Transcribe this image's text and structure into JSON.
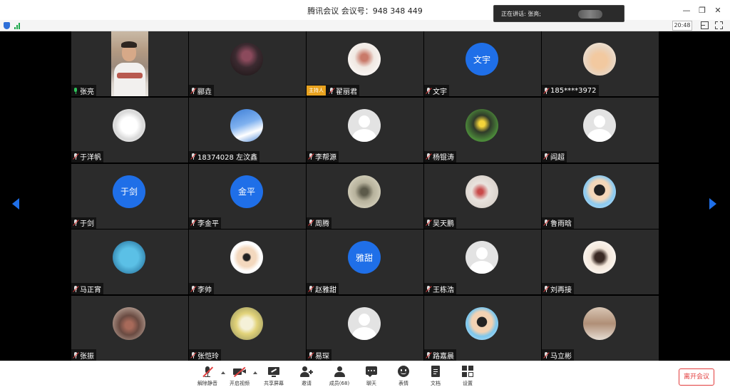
{
  "window": {
    "title": "腾讯会议 会议号：948 348 449",
    "speaking_label": "正在讲话: 张亮;"
  },
  "status": {
    "time": "20:48"
  },
  "participants": [
    {
      "name": "张亮",
      "avatar": "video",
      "mic": "on"
    },
    {
      "name": "郦垚",
      "avatar": "photo",
      "mic": "muted"
    },
    {
      "name": "翟丽君",
      "avatar": "photo",
      "mic": "muted",
      "host_badge": "主持人"
    },
    {
      "name": "文宇",
      "avatar": "text",
      "avatar_text": "文宇",
      "mic": "muted"
    },
    {
      "name": "185****3972",
      "avatar": "photo",
      "mic": "muted"
    },
    {
      "name": "于洋帆",
      "avatar": "photo",
      "mic": "muted"
    },
    {
      "name": "18374028 左汶鑫",
      "avatar": "photo",
      "mic": "muted"
    },
    {
      "name": "李帮源",
      "avatar": "default",
      "mic": "muted"
    },
    {
      "name": "杨锟涛",
      "avatar": "photo",
      "mic": "muted"
    },
    {
      "name": "阎超",
      "avatar": "default",
      "mic": "muted"
    },
    {
      "name": "于剑",
      "avatar": "text",
      "avatar_text": "于剑",
      "mic": "muted"
    },
    {
      "name": "李金平",
      "avatar": "text",
      "avatar_text": "金平",
      "mic": "muted"
    },
    {
      "name": "周腾",
      "avatar": "photo",
      "mic": "muted"
    },
    {
      "name": "吴天鹏",
      "avatar": "photo",
      "mic": "muted"
    },
    {
      "name": "鲁雨晗",
      "avatar": "photo",
      "mic": "muted"
    },
    {
      "name": "马正宵",
      "avatar": "photo",
      "mic": "muted"
    },
    {
      "name": "李帅",
      "avatar": "photo",
      "mic": "muted"
    },
    {
      "name": "赵雅甜",
      "avatar": "text",
      "avatar_text": "雅甜",
      "mic": "muted"
    },
    {
      "name": "王栋浩",
      "avatar": "default",
      "mic": "muted"
    },
    {
      "name": "刘再接",
      "avatar": "photo",
      "mic": "muted"
    },
    {
      "name": "张振",
      "avatar": "photo",
      "mic": "muted"
    },
    {
      "name": "张恺玲",
      "avatar": "photo",
      "mic": "muted"
    },
    {
      "name": "易琛",
      "avatar": "default",
      "mic": "muted"
    },
    {
      "name": "路嘉晨",
      "avatar": "photo",
      "mic": "muted"
    },
    {
      "name": "马立彬",
      "avatar": "photo",
      "mic": "muted"
    }
  ],
  "toolbar": {
    "unmute": "解除静音",
    "start_video": "开启视频",
    "share_screen": "共享屏幕",
    "invite": "邀请",
    "members": "成员(68)",
    "chat": "聊天",
    "emoji": "表情",
    "docs": "文档",
    "settings": "设置",
    "leave": "离开会议"
  },
  "colors": {
    "accent_blue": "#1f6fe8",
    "tile_bg": "#2b2b2b",
    "host_badge": "#e8a21f",
    "leave_red": "#e23c3c"
  }
}
